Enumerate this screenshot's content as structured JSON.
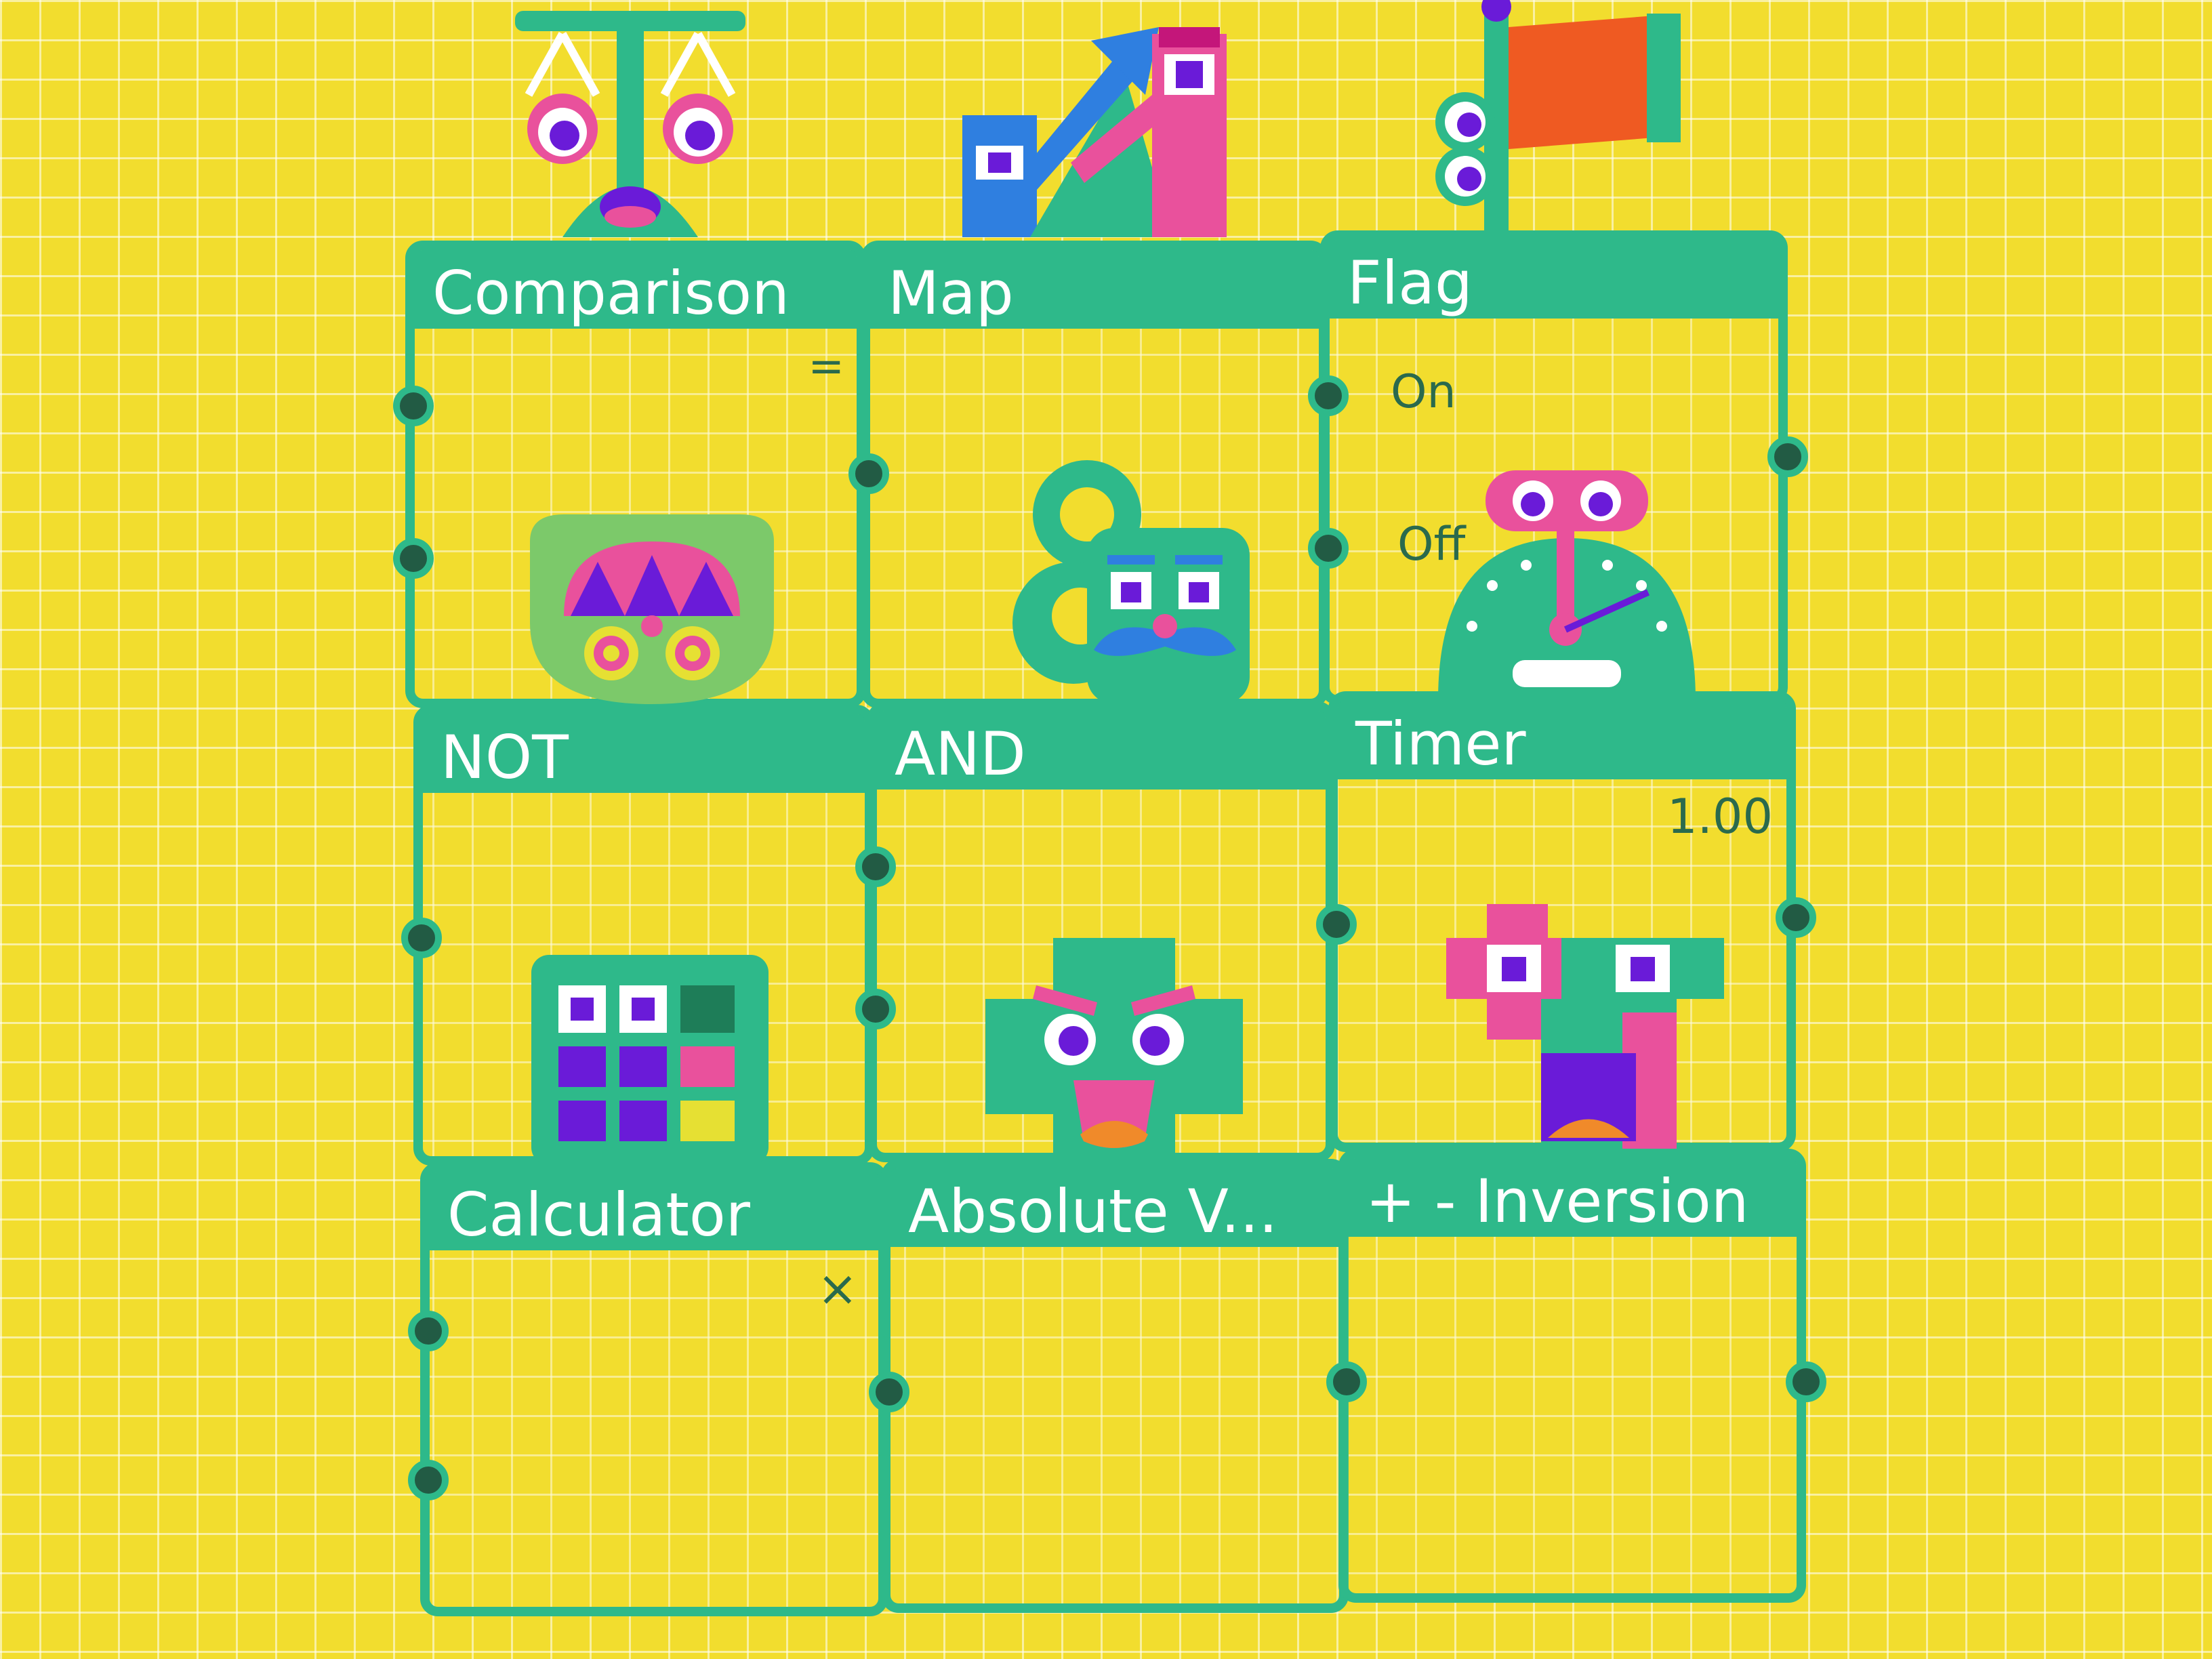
{
  "nodes": {
    "comparison": {
      "title": "Comparison",
      "operator": "="
    },
    "map": {
      "title": "Map"
    },
    "flag": {
      "title": "Flag",
      "port_on": "On",
      "port_off": "Off"
    },
    "not": {
      "title": "NOT"
    },
    "and": {
      "title": "AND"
    },
    "timer": {
      "title": "Timer",
      "value": "1.00"
    },
    "calculator": {
      "title": "Calculator",
      "operator": "×"
    },
    "absolute_value": {
      "title": "Absolute V..."
    },
    "inversion": {
      "title": "+ - Inversion"
    }
  },
  "colors": {
    "background": "#f2dd2e",
    "node_green": "#2eb98a",
    "port_dark": "#225b44",
    "accent_pink": "#e9519c",
    "accent_purple": "#6a1bd8"
  }
}
